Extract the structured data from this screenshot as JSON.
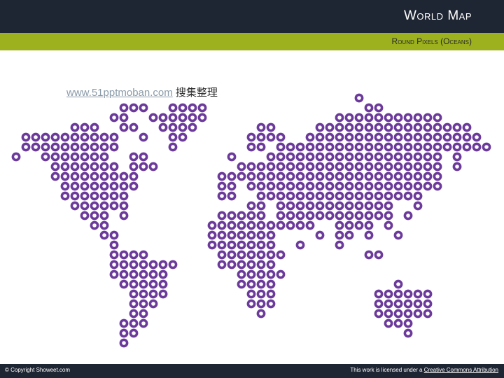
{
  "header": {
    "title": "World Map",
    "subtitle": "Round Pixels (Oceans)"
  },
  "watermark": {
    "link_text": "www.51pptmoban.com",
    "suffix": " 搜集整理"
  },
  "map": {
    "dot_color": "#6b3a9a",
    "dot_style": "ring"
  },
  "footer": {
    "copyright": "© Copyright Showeet.com",
    "license_prefix": "This work is licensed under a ",
    "license_link": "Creative Commons Attribution"
  },
  "colors": {
    "header_bg": "#1f2633",
    "accent": "#9cb11d",
    "dot": "#6b3a9a"
  }
}
